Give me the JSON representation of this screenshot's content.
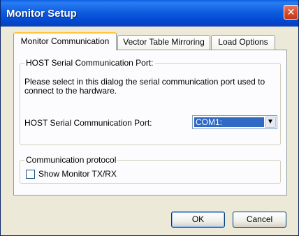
{
  "window": {
    "title": "Monitor Setup",
    "close_icon": "close-icon"
  },
  "tabs": [
    {
      "label": "Monitor Communication",
      "active": true
    },
    {
      "label": "Vector Table Mirroring",
      "active": false
    },
    {
      "label": "Load Options",
      "active": false
    }
  ],
  "port_group": {
    "title": "HOST Serial Communication Port:",
    "description": "Please select in this dialog the serial communication port used to connect to the hardware.",
    "port_label": "HOST Serial Communication Port:",
    "port_value": "COM1:",
    "dropdown_icon": "chevron-down-icon"
  },
  "protocol_group": {
    "title": "Communication protocol",
    "checkbox_label": "Show Monitor TX/RX",
    "checked": false
  },
  "buttons": {
    "ok": "OK",
    "cancel": "Cancel"
  },
  "colors": {
    "titlebar": "#0054e3",
    "selection": "#316ac5",
    "dialog_bg": "#ece9d8"
  }
}
